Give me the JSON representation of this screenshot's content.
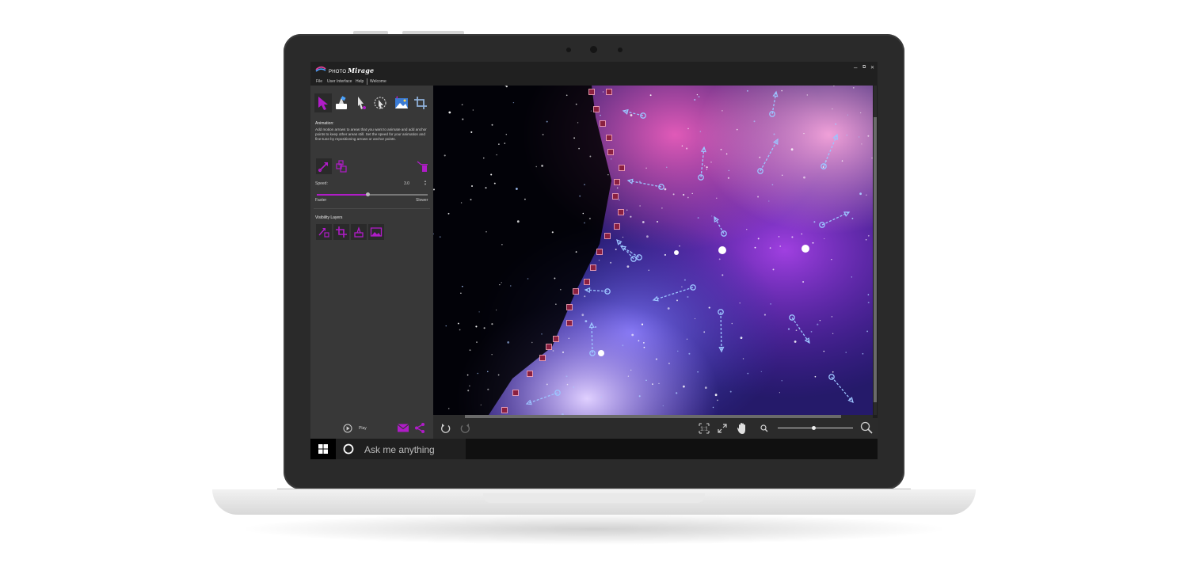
{
  "app": {
    "logo_prefix": "PHOTO",
    "logo_name": "Mirage",
    "win_minimize": "–",
    "win_restore": "⧉",
    "win_close": "✕"
  },
  "menu": {
    "items": [
      "File",
      "User Interface",
      "Help",
      "Welcome"
    ]
  },
  "colors": {
    "accent": "#b01cc8",
    "panel": "#383838",
    "titlebar": "#202020",
    "taskbar": "#101010"
  },
  "toolbar": {
    "tools": [
      "animate-arrow-icon",
      "mask-brush-icon",
      "select-pointer-icon",
      "lasso-select-icon",
      "overlay-image-icon",
      "crop-icon"
    ]
  },
  "animation_panel": {
    "title": "Animation:",
    "description": "Add motion arrows to areas that you want to animate and add anchor points to keep other areas still. Set the speed for your animation and fine-tune by repositioning arrows or anchor points.",
    "speed_label": "Speed:",
    "speed_value": "3.0",
    "speed_fraction": 0.46,
    "faster_label": "Faster",
    "slower_label": "Slower"
  },
  "visibility_layers": {
    "title": "Visibility Layers",
    "layers": [
      "arrows-layer-icon",
      "crop-layer-icon",
      "mask-layer-icon",
      "image-layer-icon"
    ]
  },
  "bottom": {
    "play_label": "Play",
    "zoom_fraction": 0.45
  },
  "taskbar": {
    "search_placeholder": "Ask me anything"
  }
}
